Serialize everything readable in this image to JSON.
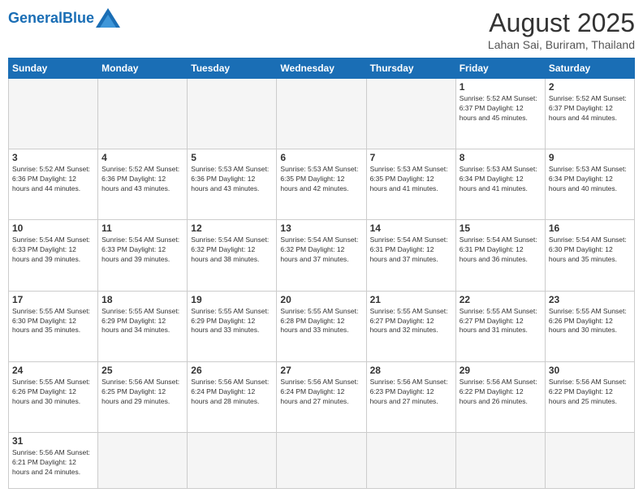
{
  "header": {
    "logo_general": "General",
    "logo_blue": "Blue",
    "month_title": "August 2025",
    "subtitle": "Lahan Sai, Buriram, Thailand"
  },
  "days_of_week": [
    "Sunday",
    "Monday",
    "Tuesday",
    "Wednesday",
    "Thursday",
    "Friday",
    "Saturday"
  ],
  "weeks": [
    [
      {
        "day": "",
        "info": ""
      },
      {
        "day": "",
        "info": ""
      },
      {
        "day": "",
        "info": ""
      },
      {
        "day": "",
        "info": ""
      },
      {
        "day": "",
        "info": ""
      },
      {
        "day": "1",
        "info": "Sunrise: 5:52 AM\nSunset: 6:37 PM\nDaylight: 12 hours and 45 minutes."
      },
      {
        "day": "2",
        "info": "Sunrise: 5:52 AM\nSunset: 6:37 PM\nDaylight: 12 hours and 44 minutes."
      }
    ],
    [
      {
        "day": "3",
        "info": "Sunrise: 5:52 AM\nSunset: 6:36 PM\nDaylight: 12 hours and 44 minutes."
      },
      {
        "day": "4",
        "info": "Sunrise: 5:52 AM\nSunset: 6:36 PM\nDaylight: 12 hours and 43 minutes."
      },
      {
        "day": "5",
        "info": "Sunrise: 5:53 AM\nSunset: 6:36 PM\nDaylight: 12 hours and 43 minutes."
      },
      {
        "day": "6",
        "info": "Sunrise: 5:53 AM\nSunset: 6:35 PM\nDaylight: 12 hours and 42 minutes."
      },
      {
        "day": "7",
        "info": "Sunrise: 5:53 AM\nSunset: 6:35 PM\nDaylight: 12 hours and 41 minutes."
      },
      {
        "day": "8",
        "info": "Sunrise: 5:53 AM\nSunset: 6:34 PM\nDaylight: 12 hours and 41 minutes."
      },
      {
        "day": "9",
        "info": "Sunrise: 5:53 AM\nSunset: 6:34 PM\nDaylight: 12 hours and 40 minutes."
      }
    ],
    [
      {
        "day": "10",
        "info": "Sunrise: 5:54 AM\nSunset: 6:33 PM\nDaylight: 12 hours and 39 minutes."
      },
      {
        "day": "11",
        "info": "Sunrise: 5:54 AM\nSunset: 6:33 PM\nDaylight: 12 hours and 39 minutes."
      },
      {
        "day": "12",
        "info": "Sunrise: 5:54 AM\nSunset: 6:32 PM\nDaylight: 12 hours and 38 minutes."
      },
      {
        "day": "13",
        "info": "Sunrise: 5:54 AM\nSunset: 6:32 PM\nDaylight: 12 hours and 37 minutes."
      },
      {
        "day": "14",
        "info": "Sunrise: 5:54 AM\nSunset: 6:31 PM\nDaylight: 12 hours and 37 minutes."
      },
      {
        "day": "15",
        "info": "Sunrise: 5:54 AM\nSunset: 6:31 PM\nDaylight: 12 hours and 36 minutes."
      },
      {
        "day": "16",
        "info": "Sunrise: 5:54 AM\nSunset: 6:30 PM\nDaylight: 12 hours and 35 minutes."
      }
    ],
    [
      {
        "day": "17",
        "info": "Sunrise: 5:55 AM\nSunset: 6:30 PM\nDaylight: 12 hours and 35 minutes."
      },
      {
        "day": "18",
        "info": "Sunrise: 5:55 AM\nSunset: 6:29 PM\nDaylight: 12 hours and 34 minutes."
      },
      {
        "day": "19",
        "info": "Sunrise: 5:55 AM\nSunset: 6:29 PM\nDaylight: 12 hours and 33 minutes."
      },
      {
        "day": "20",
        "info": "Sunrise: 5:55 AM\nSunset: 6:28 PM\nDaylight: 12 hours and 33 minutes."
      },
      {
        "day": "21",
        "info": "Sunrise: 5:55 AM\nSunset: 6:27 PM\nDaylight: 12 hours and 32 minutes."
      },
      {
        "day": "22",
        "info": "Sunrise: 5:55 AM\nSunset: 6:27 PM\nDaylight: 12 hours and 31 minutes."
      },
      {
        "day": "23",
        "info": "Sunrise: 5:55 AM\nSunset: 6:26 PM\nDaylight: 12 hours and 30 minutes."
      }
    ],
    [
      {
        "day": "24",
        "info": "Sunrise: 5:55 AM\nSunset: 6:26 PM\nDaylight: 12 hours and 30 minutes."
      },
      {
        "day": "25",
        "info": "Sunrise: 5:56 AM\nSunset: 6:25 PM\nDaylight: 12 hours and 29 minutes."
      },
      {
        "day": "26",
        "info": "Sunrise: 5:56 AM\nSunset: 6:24 PM\nDaylight: 12 hours and 28 minutes."
      },
      {
        "day": "27",
        "info": "Sunrise: 5:56 AM\nSunset: 6:24 PM\nDaylight: 12 hours and 27 minutes."
      },
      {
        "day": "28",
        "info": "Sunrise: 5:56 AM\nSunset: 6:23 PM\nDaylight: 12 hours and 27 minutes."
      },
      {
        "day": "29",
        "info": "Sunrise: 5:56 AM\nSunset: 6:22 PM\nDaylight: 12 hours and 26 minutes."
      },
      {
        "day": "30",
        "info": "Sunrise: 5:56 AM\nSunset: 6:22 PM\nDaylight: 12 hours and 25 minutes."
      }
    ],
    [
      {
        "day": "31",
        "info": "Sunrise: 5:56 AM\nSunset: 6:21 PM\nDaylight: 12 hours and 24 minutes."
      },
      {
        "day": "",
        "info": ""
      },
      {
        "day": "",
        "info": ""
      },
      {
        "day": "",
        "info": ""
      },
      {
        "day": "",
        "info": ""
      },
      {
        "day": "",
        "info": ""
      },
      {
        "day": "",
        "info": ""
      }
    ]
  ]
}
